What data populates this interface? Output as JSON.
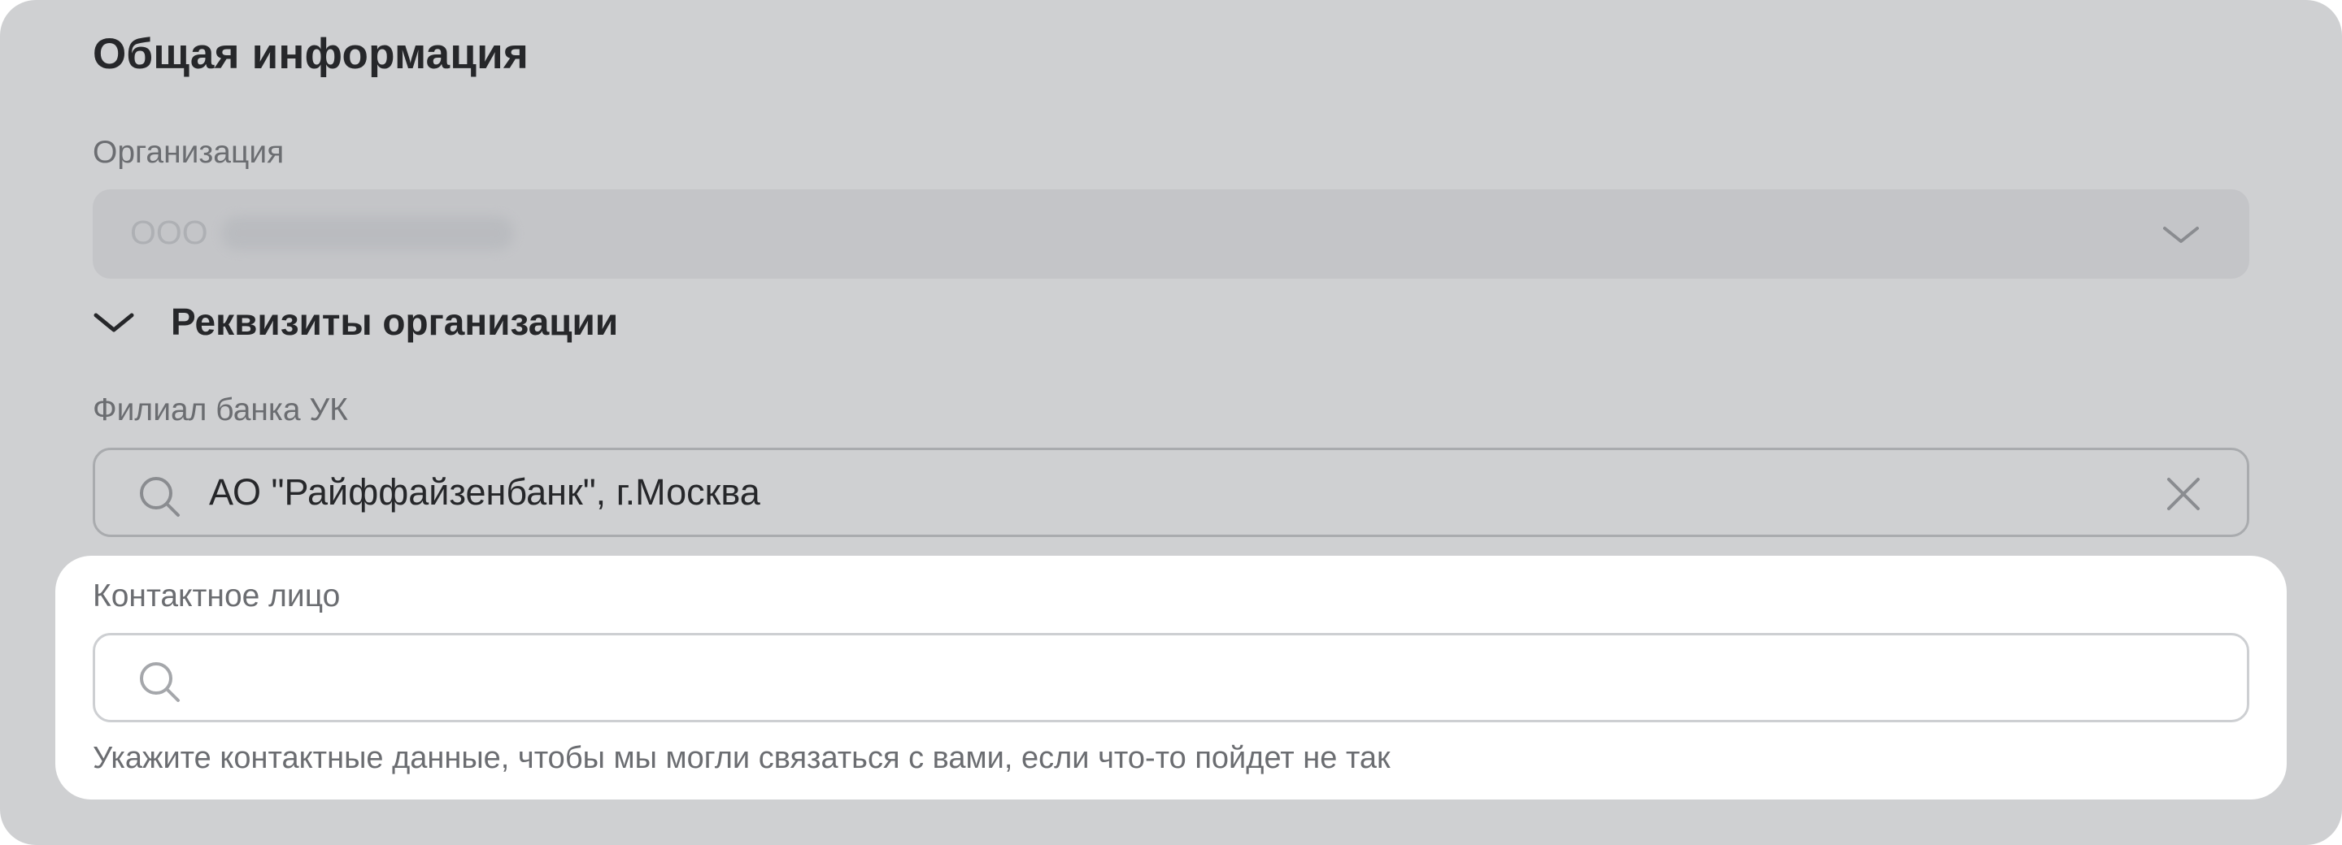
{
  "section": {
    "title": "Общая информация"
  },
  "organization": {
    "label": "Организация",
    "value_prefix": "ООО",
    "icon": "chevron-down-icon"
  },
  "requisites": {
    "label": "Реквизиты организации",
    "icon": "chevron-down-icon"
  },
  "bank_branch": {
    "label": "Филиал банка УК",
    "value": "АО \"Райффайзенбанк\", г.Москва",
    "search_icon": "search-icon",
    "clear_icon": "close-icon"
  },
  "contact_person": {
    "label": "Контактное лицо",
    "value": "",
    "search_icon": "search-icon",
    "hint": "Укажите контактные данные, чтобы мы могли связаться с вами, если что-то пойдет не так"
  },
  "colors": {
    "background": "#cfd0d2",
    "panel": "#ffffff",
    "text_primary": "#26272a",
    "text_secondary": "#6b6d71"
  }
}
